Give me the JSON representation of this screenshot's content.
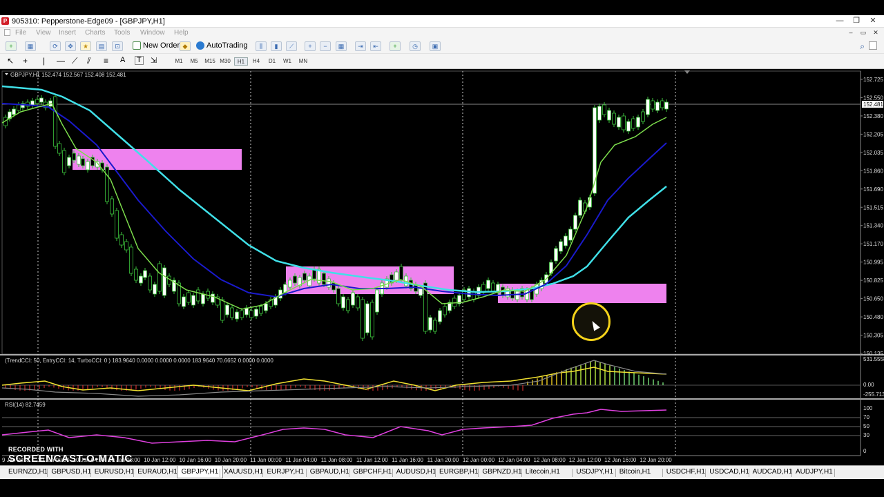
{
  "window": {
    "title": "905310: Pepperstone-Edge09 - [GBPJPY,H1]",
    "logo_letter": "P",
    "minimize_icon": "—",
    "restore_icon": "❐",
    "close_icon": "✕"
  },
  "menu": {
    "items": [
      "File",
      "View",
      "Insert",
      "Charts",
      "Tools",
      "Window",
      "Help"
    ]
  },
  "toolbar": {
    "new_order_label": "New Order",
    "autotrading_label": "AutoTrading"
  },
  "timeframes": [
    "M1",
    "M5",
    "M15",
    "M30",
    "H1",
    "H4",
    "D1",
    "W1",
    "MN"
  ],
  "active_timeframe": "H1",
  "chart": {
    "header": "GBPJPY,H1 152.474 152.567 152.408 152.481",
    "current_price": "152.481",
    "price_labels": [
      "152.725",
      "152.550",
      "152.380",
      "152.205",
      "152.035",
      "151.860",
      "151.690",
      "151.515",
      "151.340",
      "151.170",
      "150.995",
      "150.825",
      "150.650",
      "150.480",
      "150.305",
      "150.135"
    ],
    "time_labels": [
      "9 Jan 2018",
      "10 Jan 00:00",
      "10 Jan 04:00",
      "10 Jan 08:00",
      "10 Jan 12:00",
      "10 Jan 16:00",
      "10 Jan 20:00",
      "11 Jan 00:00",
      "11 Jan 04:00",
      "11 Jan 08:00",
      "11 Jan 12:00",
      "11 Jan 16:00",
      "11 Jan 20:00",
      "12 Jan 00:00",
      "12 Jan 04:00",
      "12 Jan 08:00",
      "12 Jan 12:00",
      "12 Jan 16:00",
      "12 Jan 20:00"
    ],
    "colors": {
      "background": "#000000",
      "bull_candle": "#ffffff",
      "bear_candle": "#000000",
      "candle_outline": "#3cc43c",
      "fast_ma": "#7cdc4c",
      "mid_ma": "#1a1acc",
      "slow_ma": "#40e0e8",
      "zones": "#ee82ee"
    }
  },
  "cci_panel": {
    "header": "(TrendCCI: 50, EntryCCI: 14, TurboCCI: 0 ) 183.9640 0.0000 0.0000 0.0000 183.9640 70.6652 0.0000 0.0000",
    "labels": [
      "531.5558",
      "0.00",
      "-255.713"
    ]
  },
  "rsi_panel": {
    "header": "RSI(14) 82.7459",
    "labels": [
      "100",
      "70",
      "50",
      "30",
      "0"
    ]
  },
  "tabs": [
    "EURNZD,H1",
    "GBPUSD,H1",
    "EURUSD,H1",
    "EURAUD,H1",
    "GBPJPY,H1",
    "XAUUSD,H1",
    "EURJPY,H1",
    "GBPAUD,H1",
    "GBPCHF,H1",
    "AUDUSD,H1",
    "EURGBP,H1",
    "GBPNZD,H1",
    "Litecoin,H1",
    "USDJPY,H1",
    "Bitcoin,H1",
    "USDCHF,H1",
    "USDCAD,H1",
    "AUDCAD,H1",
    "AUDJPY,H1"
  ],
  "active_tab": "GBPJPY,H1",
  "watermark": {
    "line1": "RECORDED WITH",
    "line2": "SCREENCAST-O-MATIC"
  }
}
